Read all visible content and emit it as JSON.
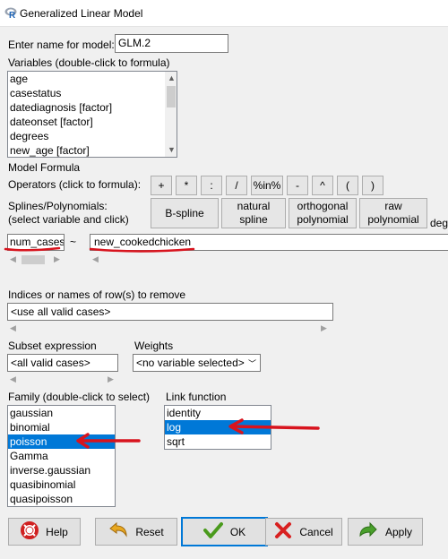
{
  "window": {
    "title": "Generalized Linear Model",
    "app_icon": "r-logo-icon"
  },
  "model_name": {
    "label": "Enter name for model:",
    "value": "GLM.2"
  },
  "variables": {
    "label": "Variables (double-click to formula)",
    "items": [
      "age",
      "casestatus",
      "datediagnosis [factor]",
      "dateonset [factor]",
      "degrees",
      "new_age [factor]"
    ]
  },
  "formula": {
    "label": "Model Formula",
    "operators_label": "Operators (click to formula):",
    "operators": [
      "+",
      "*",
      ":",
      "/",
      "%in%",
      "-",
      "^",
      "(",
      ")"
    ],
    "splines_label": "Splines/Polynomials:",
    "splines_sub": "(select variable and click)",
    "splines": [
      "B-spline",
      "natural spline",
      "orthogonal polynomial",
      "raw polynomial"
    ],
    "deg_label": "deg",
    "lhs": "num_cases",
    "tilde": "~",
    "rhs": "new_cookedchicken"
  },
  "remove": {
    "label": "Indices or names of row(s) to remove",
    "value": "<use all valid cases>"
  },
  "subset": {
    "label": "Subset expression",
    "value": "<all valid cases>"
  },
  "weights": {
    "label": "Weights",
    "value": "<no variable selected>"
  },
  "family": {
    "label": "Family (double-click to select)",
    "items": [
      "gaussian",
      "binomial",
      "poisson",
      "Gamma",
      "inverse.gaussian",
      "quasibinomial",
      "quasipoisson"
    ],
    "selected": "poisson"
  },
  "link": {
    "label": "Link function",
    "items": [
      "identity",
      "log",
      "sqrt"
    ],
    "selected": "log"
  },
  "buttons": {
    "help": "Help",
    "reset": "Reset",
    "ok": "OK",
    "cancel": "Cancel",
    "apply": "Apply"
  },
  "colors": {
    "accent": "#0078d7",
    "annotation": "#d8141e"
  }
}
